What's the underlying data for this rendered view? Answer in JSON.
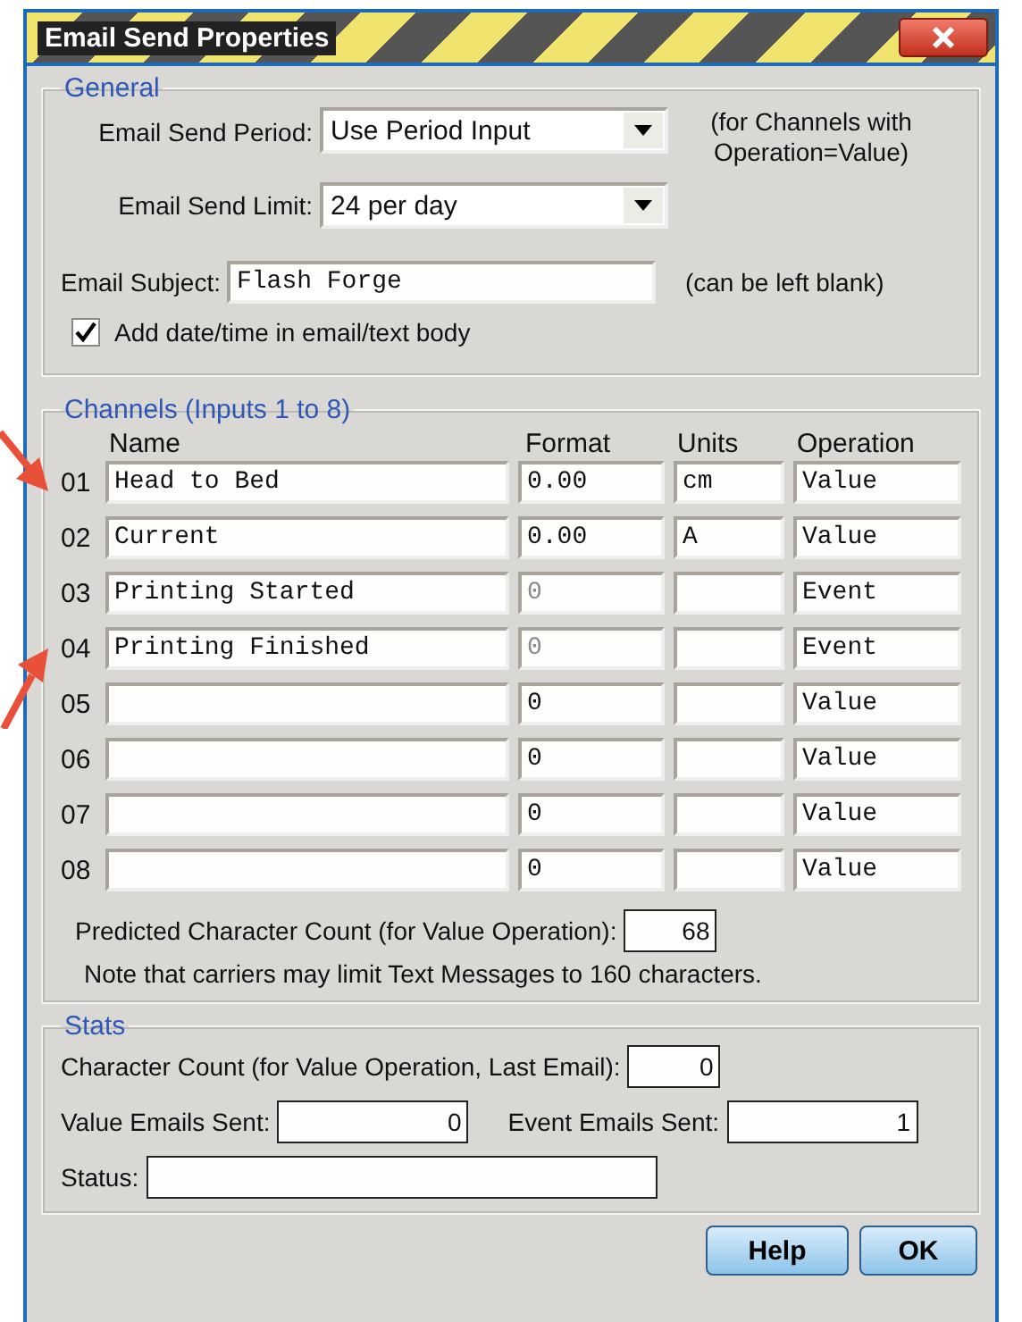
{
  "window": {
    "title": "Email Send Properties"
  },
  "general": {
    "title": "General",
    "period": {
      "label": "Email Send Period:",
      "value": "Use Period Input",
      "note": "(for Channels with Operation=Value)"
    },
    "limit": {
      "label": "Email Send Limit:",
      "value": "24 per day"
    },
    "subject": {
      "label": "Email Subject:",
      "value": "Flash Forge",
      "note": "(can be left blank)"
    },
    "add_datetime": {
      "label": "Add date/time in email/text body",
      "checked": true
    }
  },
  "channels": {
    "title": "Channels (Inputs 1 to 8)",
    "columns": [
      "Name",
      "Format",
      "Units",
      "Operation"
    ],
    "rows": [
      {
        "number": "01",
        "name": "Head to Bed",
        "format": "0.00",
        "format_disabled": false,
        "units": "cm",
        "operation": "Value"
      },
      {
        "number": "02",
        "name": "Current",
        "format": "0.00",
        "format_disabled": false,
        "units": "A",
        "operation": "Value"
      },
      {
        "number": "03",
        "name": "Printing Started",
        "format": "0",
        "format_disabled": true,
        "units": "",
        "operation": "Event"
      },
      {
        "number": "04",
        "name": "Printing Finished",
        "format": "0",
        "format_disabled": true,
        "units": "",
        "operation": "Event"
      },
      {
        "number": "05",
        "name": "",
        "format": "0",
        "format_disabled": false,
        "units": "",
        "operation": "Value"
      },
      {
        "number": "06",
        "name": "",
        "format": "0",
        "format_disabled": false,
        "units": "",
        "operation": "Value"
      },
      {
        "number": "07",
        "name": "",
        "format": "0",
        "format_disabled": false,
        "units": "",
        "operation": "Value"
      },
      {
        "number": "08",
        "name": "",
        "format": "0",
        "format_disabled": false,
        "units": "",
        "operation": "Value"
      }
    ],
    "predicted": {
      "label": "Predicted Character Count (for Value Operation):",
      "value": "68"
    },
    "note": "Note that carriers may limit Text Messages to 160 characters."
  },
  "stats": {
    "title": "Stats",
    "char_count": {
      "label": "Character Count (for Value Operation, Last Email):",
      "value": "0"
    },
    "value_sent": {
      "label": "Value Emails Sent:",
      "value": "0"
    },
    "event_sent": {
      "label": "Event Emails Sent:",
      "value": "1"
    },
    "status": {
      "label": "Status:"
    }
  },
  "buttons": [
    "Help",
    "OK"
  ]
}
